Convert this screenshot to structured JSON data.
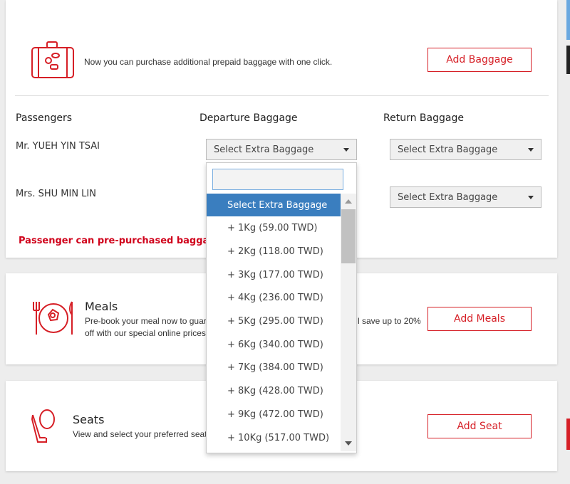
{
  "baggage": {
    "intro": "Now you can purchase additional prepaid baggage with one click.",
    "button": "Add Baggage",
    "headers": {
      "passengers": "Passengers",
      "departure": "Departure Baggage",
      "return": "Return Baggage"
    },
    "passengers": [
      {
        "name": "Mr. YUEH YIN TSAI",
        "departure": "Select Extra Baggage",
        "return": "Select Extra Baggage"
      },
      {
        "name": "Mrs. SHU MIN LIN",
        "return": "Select Extra Baggage"
      }
    ],
    "warning": "Passenger can pre-purchased baggage no",
    "dropdown": {
      "search_value": "",
      "options": [
        "Select Extra Baggage",
        "+ 1Kg (59.00 TWD)",
        "+ 2Kg (118.00 TWD)",
        "+ 3Kg (177.00 TWD)",
        "+ 4Kg (236.00 TWD)",
        "+ 5Kg (295.00 TWD)",
        "+ 6Kg (340.00 TWD)",
        "+ 7Kg (384.00 TWD)",
        "+ 8Kg (428.00 TWD)",
        "+ 9Kg (472.00 TWD)",
        "+ 10Kg (517.00 TWD)"
      ],
      "selected": "Select Extra Baggage"
    }
  },
  "meals": {
    "title": "Meals",
    "desc_left_1": "Pre-book your meal now to guara",
    "desc_left_2": "off with our special online prices",
    "desc_right": "l save up to 20%",
    "button": "Add Meals"
  },
  "seats": {
    "title": "Seats",
    "desc": "View and select your preferred seats",
    "button": "Add Seat"
  },
  "colors": {
    "accent": "#d61f26",
    "selected": "#3a7ebf"
  }
}
